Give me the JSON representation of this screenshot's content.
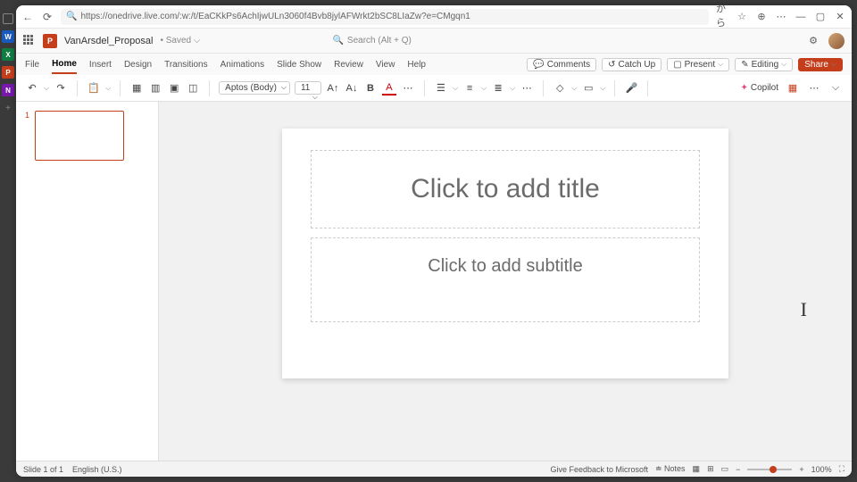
{
  "browser": {
    "url": "https://onedrive.live.com/:w:/t/EaCKkPs6AchIjwULn3060f4Bvb8jylAFWrkt2bSC8LIaZw?e=CMgqn1"
  },
  "titlebar": {
    "doc_name": "VanArsdel_Proposal",
    "saved_state": "• Saved ⌵",
    "search_placeholder": "Search (Alt + Q)"
  },
  "tabs": {
    "items": [
      "File",
      "Home",
      "Insert",
      "Design",
      "Transitions",
      "Animations",
      "Slide Show",
      "Review",
      "View",
      "Help"
    ],
    "active": "Home",
    "comments": "Comments",
    "catchup": "Catch Up",
    "present": "Present",
    "editing": "Editing",
    "share": "Share"
  },
  "ribbon": {
    "font_name": "Aptos (Body)",
    "font_size": "11",
    "copilot": "Copilot"
  },
  "slide": {
    "title_placeholder": "Click to add title",
    "subtitle_placeholder": "Click to add subtitle",
    "thumb_num": "1"
  },
  "status": {
    "slide_info": "Slide 1 of 1",
    "language": "English (U.S.)",
    "feedback": "Give Feedback to Microsoft",
    "notes": "Notes",
    "zoom": "100%"
  }
}
